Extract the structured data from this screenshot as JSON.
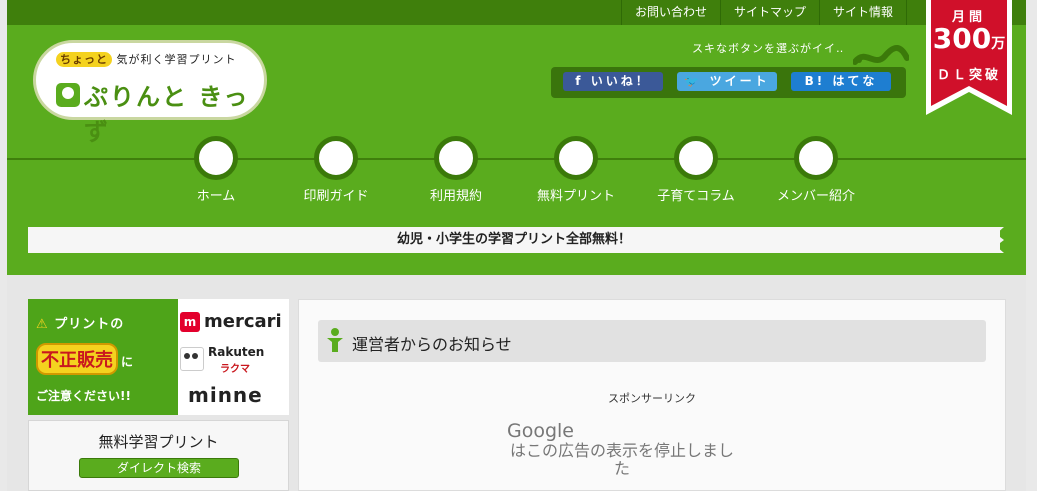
{
  "top_links": [
    "お問い合わせ",
    "サイトマップ",
    "サイト情報"
  ],
  "logo": {
    "tagline_highlight": "ちょっと",
    "tagline_rest": "気が利く学習プリント",
    "name": "ぷりんと きっず"
  },
  "share": {
    "prompt": "スキなボタンを選ぶがイイ‥",
    "facebook": "いいね！",
    "twitter": "ツイート",
    "hatena": "はてな"
  },
  "ribbon": {
    "line1": "月間",
    "number": "300",
    "unit": "万",
    "line3": "ＤＬ突破"
  },
  "nav": [
    "ホーム",
    "印刷ガイド",
    "利用規約",
    "無料プリント",
    "子育てコラム",
    "メンバー紹介"
  ],
  "banner": "幼児・小学生の学習プリント全部無料！",
  "side_ad": {
    "line1": "プリントの",
    "line2_box": "不正販売",
    "line2_suffix": "に",
    "line3": "ご注意ください!!",
    "brand1": "mercari",
    "brand2": "Rakuten",
    "brand2_sub": "ラクマ",
    "brand3": "minne"
  },
  "side_box": {
    "title": "無料学習プリント",
    "button": "ダイレクト検索"
  },
  "main": {
    "heading": "運営者からのお知らせ",
    "sponsor": "スポンサーリンク",
    "google": "Google",
    "ad_message": "はこの広告の表示を停止しました"
  },
  "colors": {
    "green": "#5aac1e",
    "dark_green": "#3f7f0c",
    "ribbon_red": "#d0102a"
  }
}
